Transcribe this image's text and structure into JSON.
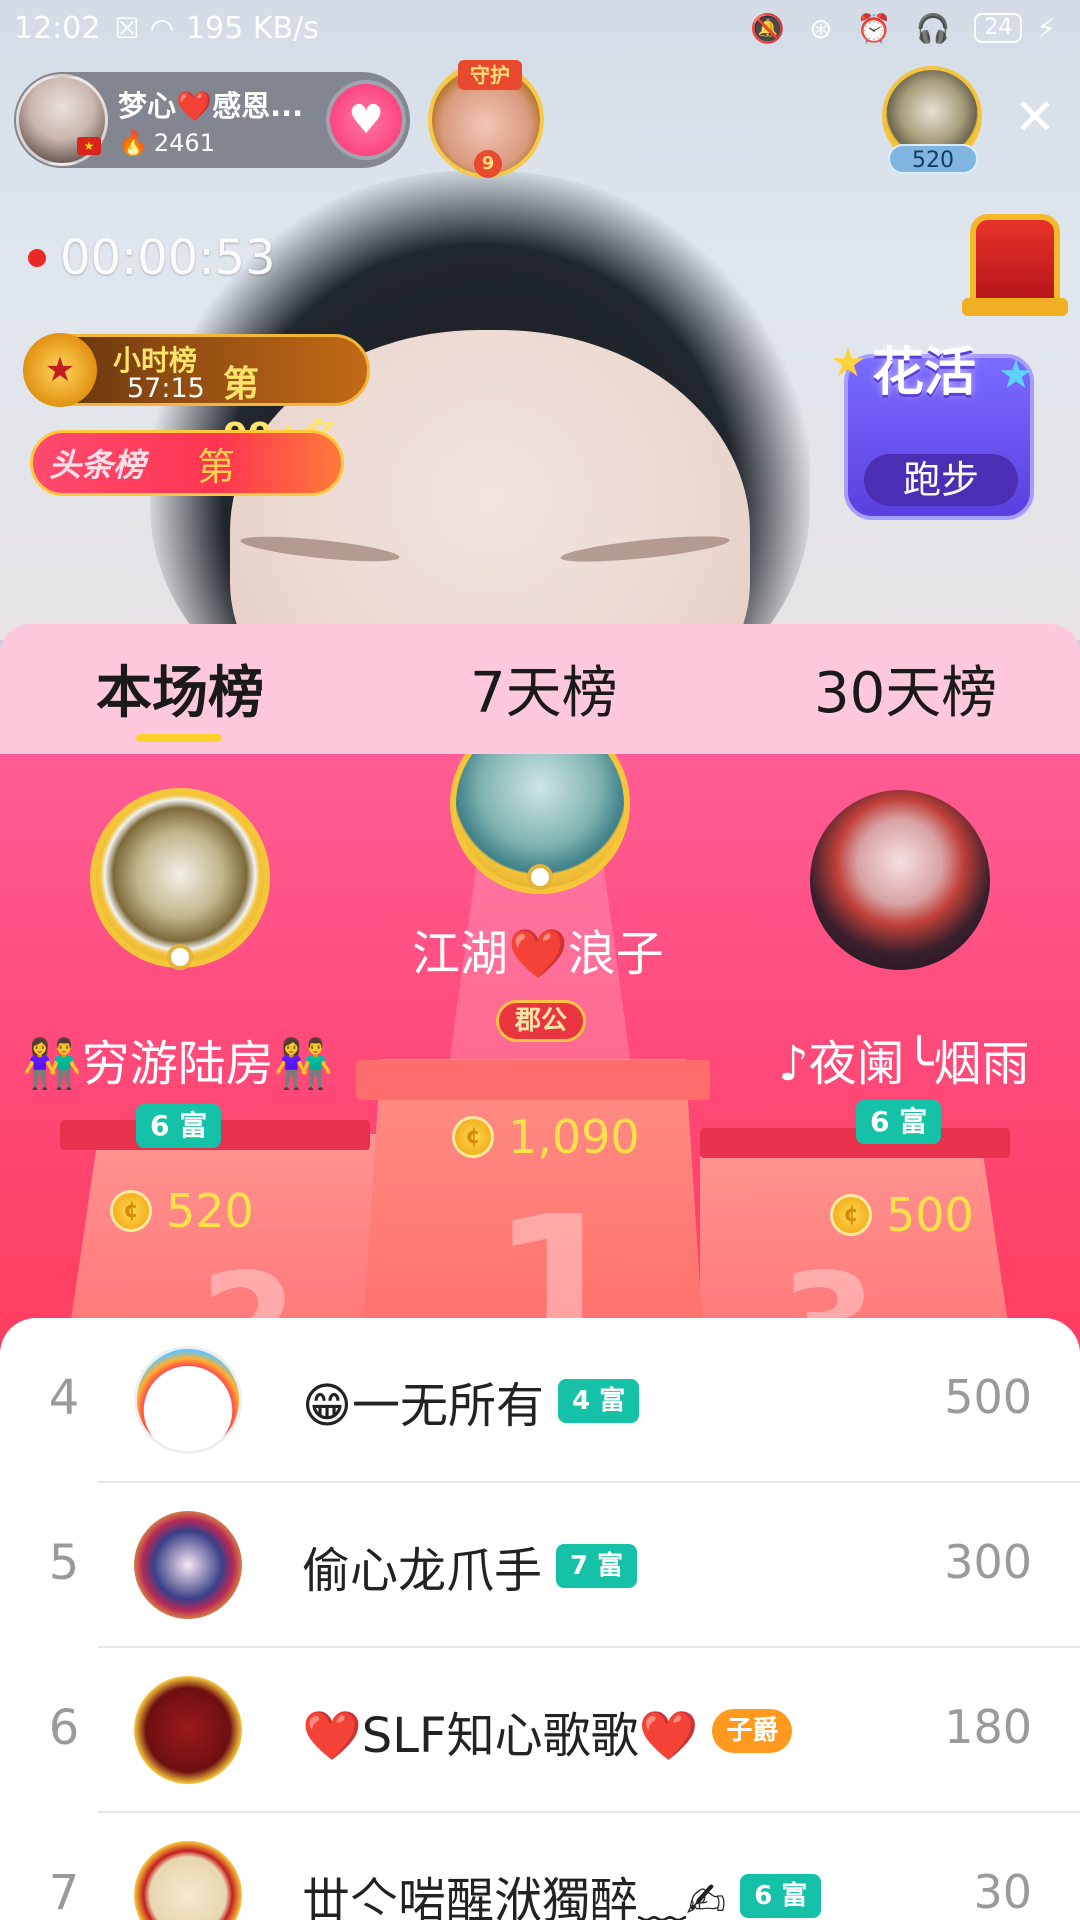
{
  "status_bar": {
    "time": "12:02",
    "speed": "195 KB/s",
    "battery": "24"
  },
  "host": {
    "name": "梦心❤️感恩...",
    "heat": "2461"
  },
  "guard": {
    "label": "守护",
    "level": "9"
  },
  "viewer": {
    "count": "520"
  },
  "live": {
    "duration": "00:00:53"
  },
  "hour_rank": {
    "label": "小时榜",
    "countdown": "57:15",
    "rank": "第99+名"
  },
  "headline_rank": {
    "label": "头条榜",
    "rank": "第"
  },
  "activity": {
    "title": "花活",
    "button": "跑步"
  },
  "tabs": [
    "本场榜",
    "7天榜",
    "30天榜"
  ],
  "active_tab": "本场榜",
  "podium": {
    "first": {
      "name": "江湖❤️浪子",
      "badge": "郡公",
      "coins": "1,090",
      "place": "1"
    },
    "second": {
      "name": "👫穷游陆房👫",
      "badge": "6 富",
      "coins": "520",
      "place": "2"
    },
    "third": {
      "name": "♪夜阑╰烟雨",
      "badge": "6 富",
      "coins": "500",
      "place": "3"
    }
  },
  "list": [
    {
      "rank": "4",
      "name": "😁一无所有",
      "badge": "4 富",
      "badge_style": "teal",
      "score": "500"
    },
    {
      "rank": "5",
      "name": "偷心龙爪手",
      "badge": "7 富",
      "badge_style": "teal",
      "score": "300"
    },
    {
      "rank": "6",
      "name": "❤️SLF知心歌歌❤️",
      "badge": "子爵",
      "badge_style": "orange",
      "score": "180"
    },
    {
      "rank": "7",
      "name": "丗亽啱醒洑獨醉﹏✍",
      "badge": "6 富",
      "badge_style": "teal",
      "score": "30"
    }
  ],
  "colors": {
    "tab_bar": "#ffc8dc",
    "podium": "#ff4a7a",
    "rich_badge": "#15c2a8",
    "coin_text": "#ffe14a"
  }
}
